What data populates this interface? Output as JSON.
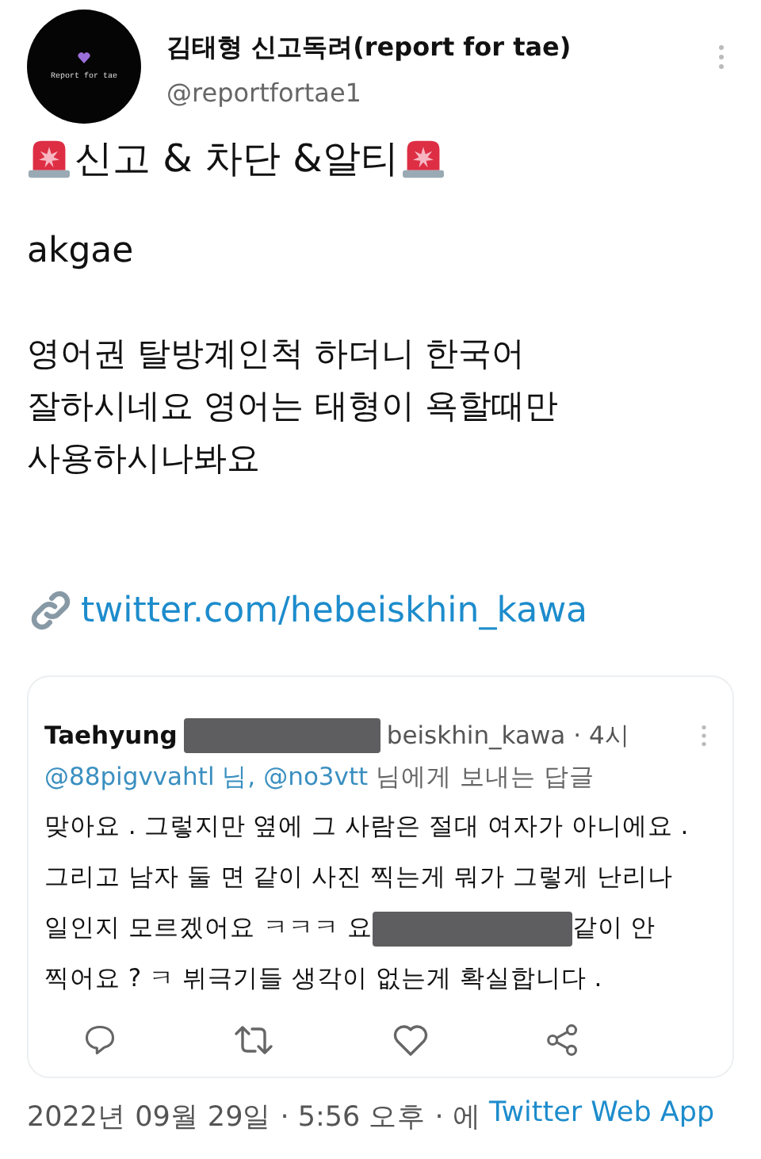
{
  "author": {
    "avatar_text": "Report for tae",
    "name": "김태형 신고독려(report for tae)",
    "handle": "@reportfortae1"
  },
  "tweet": {
    "heading": "신고 & 차단 &알티",
    "account": "akgae",
    "body": "영어권 탈방계인척 하더니 한국어\n잘하시네요 영어는 태형이 욕할때만\n사용하시나봐요",
    "link": "twitter.com/hebeiskhin_kawa"
  },
  "quoted": {
    "header": [
      {
        "kind": "name",
        "text": "Taehyung"
      },
      {
        "kind": "redacted"
      },
      {
        "kind": "text",
        "text": "beiskhin_kawa · 4시"
      }
    ],
    "reply_to": [
      {
        "kind": "mention",
        "text": "@88pigvvahtl 님,"
      },
      {
        "kind": "mention",
        "text": "@no3vtt"
      },
      {
        "kind": "text",
        "text": "님에게 보내는 답글"
      }
    ],
    "lines": [
      [
        {
          "kind": "text",
          "text": "맞아요 . 그렇지만 옆에 그 사람은 절대 여자가 아니에요 ."
        }
      ],
      [
        {
          "kind": "text",
          "text": "그리고 남자 둘 면 같이 사진 찍는게 뭐가 그렇게 난리나"
        }
      ],
      [
        {
          "kind": "text",
          "text": "일인지 모르겠어요 ㅋㅋㅋ 요"
        },
        {
          "kind": "redacted"
        },
        {
          "kind": "text",
          "text": "같이 안"
        }
      ],
      [
        {
          "kind": "text",
          "text": "찍어요 ? ㅋ  뷔극기들 생각이 없는게 확실합니다 ."
        }
      ]
    ]
  },
  "footer": {
    "date": "2022년 09월 29일 · 5:56 오후 · 에",
    "source": "Twitter Web App"
  }
}
